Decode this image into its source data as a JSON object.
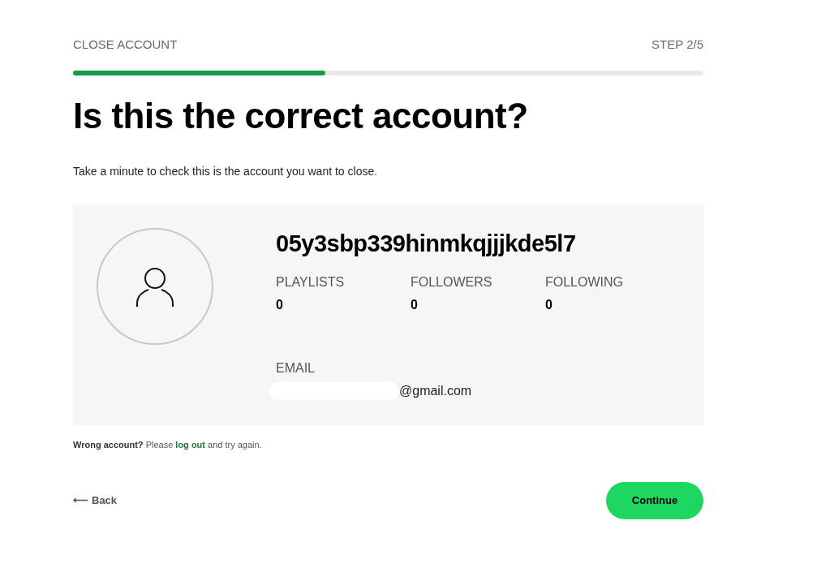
{
  "header": {
    "title": "CLOSE ACCOUNT",
    "step": "STEP 2/5"
  },
  "progress": {
    "level": 0.4
  },
  "heading": "Is this the correct account?",
  "intro": "Take a minute to check this is the account you want to close.",
  "account": {
    "username": "05y3sbp339hinmkqjjjkde5l7",
    "stats": [
      {
        "label": "PLAYLISTS",
        "value": "0"
      },
      {
        "label": "FOLLOWERS",
        "value": "0"
      },
      {
        "label": "FOLLOWING",
        "value": "0"
      }
    ],
    "email_label": "EMAIL",
    "email": "@gmail.com",
    "email_redacted": true
  },
  "hint": {
    "before": "**Wrong account?** Please",
    "link": "log out",
    "after": "and try again."
  },
  "back": {
    "arrow": "⟵",
    "label": "Back"
  },
  "continue": "Continue"
}
